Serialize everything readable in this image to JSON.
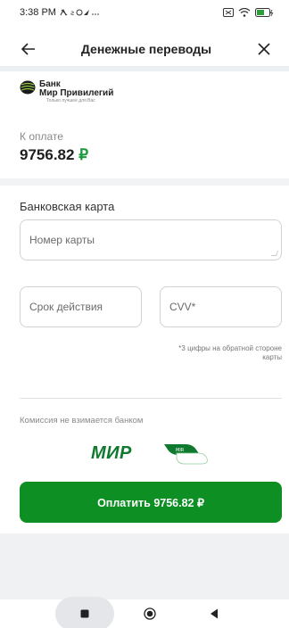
{
  "status_bar": {
    "time": "3:38 PM"
  },
  "app_bar": {
    "title": "Денежные переводы"
  },
  "bank": {
    "name_line1": "Банк",
    "name_line2": "Мир Привилегий",
    "tagline": "Только лучшее для Вас"
  },
  "payment": {
    "label": "К оплате",
    "amount": "9756.82",
    "currency": "₽"
  },
  "card": {
    "section_label": "Банковская карта",
    "number_placeholder": "Номер карты",
    "expiry_placeholder": "Срок действия",
    "cvv_placeholder": "CVV*",
    "cvv_hint": "*3 цифры на обратной стороне карты"
  },
  "commission_text": "Комиссия не взимается банком",
  "mir_logo_text": "МИР",
  "pay_button": {
    "label": "Оплатить 9756.82 ₽"
  },
  "colors": {
    "accent": "#0d8f24",
    "ruble": "#1a9a3a",
    "mir": "#0f7a2f"
  },
  "icons": [
    "back-arrow-icon",
    "close-icon",
    "mir-pay-icon",
    "recents-icon",
    "home-icon",
    "back-icon"
  ]
}
